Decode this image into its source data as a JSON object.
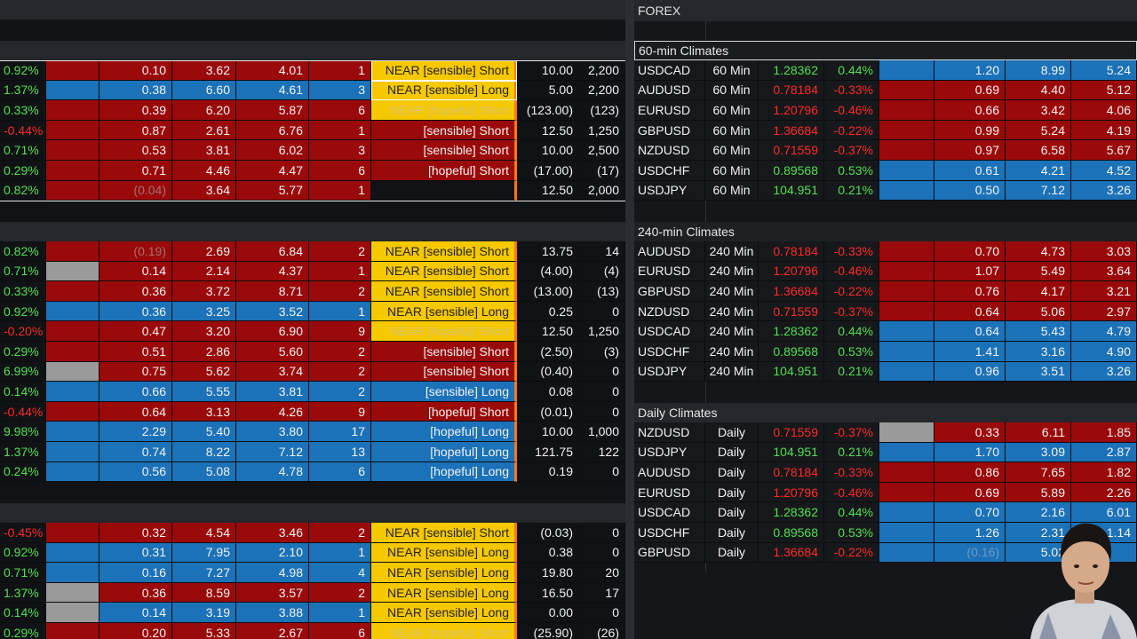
{
  "forex_title": "FOREX",
  "left_rows_a": [
    [
      "0.92%",
      "",
      "0.10",
      "3.62",
      "4.01",
      "1",
      "NEAR [sensible] Short",
      "10.00",
      "2,200"
    ],
    [
      "1.37%",
      "",
      "0.38",
      "6.60",
      "4.61",
      "3",
      "NEAR [sensible] Long",
      "5.00",
      "2,200"
    ],
    [
      "0.33%",
      "",
      "0.39",
      "6.20",
      "5.87",
      "6",
      "NEAR [hopeful] Short",
      "(123.00)",
      "(123)"
    ],
    [
      "-0.44%",
      "",
      "0.87",
      "2.61",
      "6.76",
      "1",
      "[sensible] Short",
      "12.50",
      "1,250"
    ],
    [
      "0.71%",
      "",
      "0.53",
      "3.81",
      "6.02",
      "3",
      "[sensible] Short",
      "10.00",
      "2,500"
    ],
    [
      "0.29%",
      "",
      "0.71",
      "4.46",
      "4.47",
      "6",
      "[hopeful] Short",
      "(17.00)",
      "(17)"
    ],
    [
      "0.82%",
      "",
      "(0.04)",
      "3.64",
      "5.77",
      "1",
      "",
      "12.50",
      "2,000"
    ]
  ],
  "left_rows_b": [
    [
      "0.82%",
      "",
      "(0.19)",
      "2.69",
      "6.84",
      "2",
      "NEAR [sensible] Short",
      "13.75",
      "14"
    ],
    [
      "0.71%",
      "",
      "0.14",
      "2.14",
      "4.37",
      "1",
      "NEAR [sensible] Short",
      "(4.00)",
      "(4)"
    ],
    [
      "0.33%",
      "",
      "0.36",
      "3.72",
      "8.71",
      "2",
      "NEAR [sensible] Short",
      "(13.00)",
      "(13)"
    ],
    [
      "0.92%",
      "",
      "0.36",
      "3.25",
      "3.52",
      "1",
      "NEAR [sensible] Long",
      "0.25",
      "0"
    ],
    [
      "-0.20%",
      "",
      "0.47",
      "3.20",
      "6.90",
      "9",
      "NEAR [hopeful] Short",
      "12.50",
      "1,250"
    ],
    [
      "0.29%",
      "",
      "0.51",
      "2.86",
      "5.60",
      "2",
      "[sensible] Short",
      "(2.50)",
      "(3)"
    ],
    [
      "6.99%",
      "",
      "0.75",
      "5.62",
      "3.74",
      "2",
      "[sensible] Short",
      "(0.40)",
      "0"
    ],
    [
      "0.14%",
      "",
      "0.66",
      "5.55",
      "3.81",
      "2",
      "[sensible] Long",
      "0.08",
      "0"
    ],
    [
      "-0.44%",
      "",
      "0.64",
      "3.13",
      "4.26",
      "9",
      "[hopeful] Short",
      "(0.01)",
      "0"
    ],
    [
      "9.98%",
      "",
      "2.29",
      "5.40",
      "3.80",
      "17",
      "[hopeful] Long",
      "10.00",
      "1,000"
    ],
    [
      "1.37%",
      "",
      "0.74",
      "8.22",
      "7.12",
      "13",
      "[hopeful] Long",
      "121.75",
      "122"
    ],
    [
      "0.24%",
      "",
      "0.56",
      "5.08",
      "4.78",
      "6",
      "[hopeful] Long",
      "0.19",
      "0"
    ]
  ],
  "left_rows_c": [
    [
      "-0.45%",
      "",
      "0.32",
      "4.54",
      "3.46",
      "2",
      "NEAR [sensible] Short",
      "(0.03)",
      "0"
    ],
    [
      "0.92%",
      "",
      "0.31",
      "7.95",
      "2.10",
      "1",
      "NEAR [sensible] Long",
      "0.38",
      "0"
    ],
    [
      "0.71%",
      "",
      "0.16",
      "7.27",
      "4.98",
      "4",
      "NEAR [sensible] Long",
      "19.80",
      "20"
    ],
    [
      "1.37%",
      "",
      "0.36",
      "8.59",
      "3.57",
      "2",
      "NEAR [sensible] Long",
      "16.50",
      "17"
    ],
    [
      "0.14%",
      "",
      "0.14",
      "3.19",
      "3.88",
      "1",
      "NEAR [sensible] Long",
      "0.00",
      "0"
    ],
    [
      "0.29%",
      "",
      "0.20",
      "5.33",
      "2.67",
      "6",
      "NEAR [hopeful] Short",
      "(25.90)",
      "(26)"
    ]
  ],
  "sections": {
    "min60": {
      "title": "60-min Climates",
      "rows": [
        [
          "USDCAD",
          "60 Min",
          "1.28362",
          "0.44%",
          "",
          "1.20",
          "8.99",
          "5.24"
        ],
        [
          "AUDUSD",
          "60 Min",
          "0.78184",
          "-0.33%",
          "",
          "0.69",
          "4.40",
          "5.12"
        ],
        [
          "EURUSD",
          "60 Min",
          "1.20796",
          "-0.46%",
          "",
          "0.66",
          "3.42",
          "4.06"
        ],
        [
          "GBPUSD",
          "60 Min",
          "1.36684",
          "-0.22%",
          "",
          "0.99",
          "5.24",
          "4.19"
        ],
        [
          "NZDUSD",
          "60 Min",
          "0.71559",
          "-0.37%",
          "",
          "0.97",
          "6.58",
          "5.67"
        ],
        [
          "USDCHF",
          "60 Min",
          "0.89568",
          "0.53%",
          "",
          "0.61",
          "4.21",
          "4.52"
        ],
        [
          "USDJPY",
          "60 Min",
          "104.951",
          "0.21%",
          "",
          "0.50",
          "7.12",
          "3.26"
        ]
      ]
    },
    "min240": {
      "title": "240-min Climates",
      "rows": [
        [
          "AUDUSD",
          "240 Min",
          "0.78184",
          "-0.33%",
          "",
          "0.70",
          "4.73",
          "3.03"
        ],
        [
          "EURUSD",
          "240 Min",
          "1.20796",
          "-0.46%",
          "",
          "1.07",
          "5.49",
          "3.64"
        ],
        [
          "GBPUSD",
          "240 Min",
          "1.36684",
          "-0.22%",
          "",
          "0.76",
          "4.17",
          "3.21"
        ],
        [
          "NZDUSD",
          "240 Min",
          "0.71559",
          "-0.37%",
          "",
          "0.64",
          "5.06",
          "2.97"
        ],
        [
          "USDCAD",
          "240 Min",
          "1.28362",
          "0.44%",
          "",
          "0.64",
          "5.43",
          "4.79"
        ],
        [
          "USDCHF",
          "240 Min",
          "0.89568",
          "0.53%",
          "",
          "1.41",
          "3.16",
          "4.90"
        ],
        [
          "USDJPY",
          "240 Min",
          "104.951",
          "0.21%",
          "",
          "0.96",
          "3.51",
          "3.26"
        ]
      ]
    },
    "daily": {
      "title": "Daily Climates",
      "rows": [
        [
          "NZDUSD",
          "Daily",
          "0.71559",
          "-0.37%",
          "",
          "0.33",
          "6.11",
          "1.85"
        ],
        [
          "USDJPY",
          "Daily",
          "104.951",
          "0.21%",
          "",
          "1.70",
          "3.09",
          "2.87"
        ],
        [
          "AUDUSD",
          "Daily",
          "0.78184",
          "-0.33%",
          "",
          "0.86",
          "7.65",
          "1.82"
        ],
        [
          "EURUSD",
          "Daily",
          "1.20796",
          "-0.46%",
          "",
          "0.69",
          "5.89",
          "2.26"
        ],
        [
          "USDCAD",
          "Daily",
          "1.28362",
          "0.44%",
          "",
          "0.70",
          "2.16",
          "6.01"
        ],
        [
          "USDCHF",
          "Daily",
          "0.89568",
          "0.53%",
          "",
          "1.26",
          "2.31",
          "1.14"
        ],
        [
          "GBPUSD",
          "Daily",
          "1.36684",
          "-0.22%",
          "",
          "(0.16)",
          "5.02",
          ""
        ]
      ]
    }
  },
  "colors": {
    "red_cell": "#9b0a0a",
    "blue_cell": "#1c72b8",
    "yellow_cell": "#f5c800",
    "gray_cell": "#9a9a9a",
    "positive_text": "#52e052",
    "negative_text": "#ff2a2a"
  }
}
